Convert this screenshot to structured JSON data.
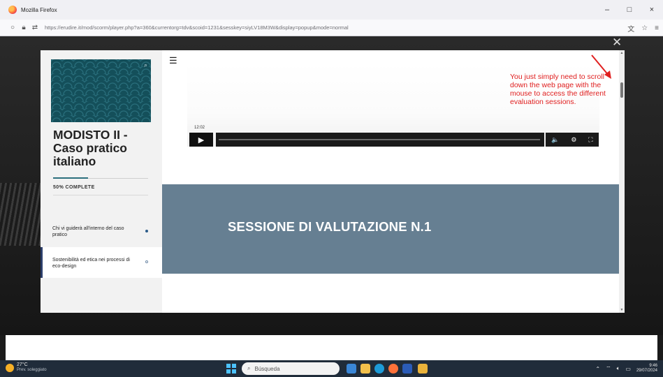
{
  "browser": {
    "window_title": "Mozilla Firefox",
    "url": "https://erudire.it/mod/scorm/player.php?a=360&currentorg=tdv&scoid=1231&sesskey=siyLV18M3W&display=popup&mode=normal",
    "controls": {
      "minimize": "–",
      "maximize": "□",
      "close": "×"
    }
  },
  "sidebar": {
    "course_title": "MODISTO II - Caso pratico italiano",
    "progress_text": "50% COMPLETE",
    "lessons": [
      {
        "label": "Chi vi guiderà all'interno del caso pratico",
        "state": "active"
      },
      {
        "label": "Sostenibilità ed etica nei processi di eco-design",
        "state": "current"
      }
    ]
  },
  "video": {
    "timestamp": "12:02",
    "play_glyph": "▶",
    "volume_glyph": "🔈",
    "settings_glyph": "⚙",
    "fullscreen_glyph": "⛶"
  },
  "annotation": {
    "text": "You just simply need to scroll down the web page with the mouse to access the different evaluation sessions.",
    "color": "#e02020"
  },
  "session": {
    "title": "SESSIONE DI VALUTAZIONE N.1",
    "band_color": "#667f92"
  },
  "taskbar": {
    "temperature": "27°C",
    "weather_desc": "Prev. soleggiato",
    "search_placeholder": "Búsqueda",
    "time": "9:46",
    "date": "29/07/2024"
  }
}
